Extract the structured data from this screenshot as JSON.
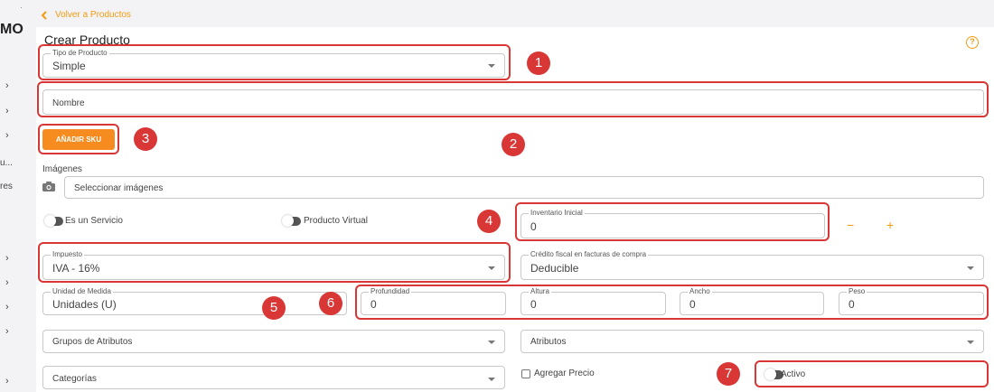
{
  "sidebar": {
    "logo": "MO",
    "dot": "·",
    "truncated_1": "u...",
    "truncated_2": "res",
    "chevron": "›"
  },
  "nav": {
    "back_label": "Volver a Productos",
    "back_icon": "chevron-left-icon"
  },
  "page": {
    "title": "Crear Producto",
    "help_glyph": "?"
  },
  "form": {
    "tipo": {
      "label": "Tipo de Producto",
      "value": "Simple"
    },
    "nombre": {
      "placeholder": "Nombre"
    },
    "add_sku": "AÑADIR SKU",
    "imagenes": {
      "label": "Imágenes",
      "placeholder": "Seleccionar imágenes"
    },
    "es_servicio": "Es un Servicio",
    "producto_virtual": "Producto Virtual",
    "inventario": {
      "label": "Inventario Inicial",
      "value": "0",
      "minus": "−",
      "plus": "+"
    },
    "impuesto": {
      "label": "Impuesto",
      "value": "IVA - 16%"
    },
    "credito": {
      "label": "Crédito fiscal en facturas de compra",
      "value": "Deducible"
    },
    "unidad": {
      "label": "Unidad de Medida",
      "value": "Unidades (U)"
    },
    "profundidad": {
      "label": "Profundidad",
      "value": "0"
    },
    "altura": {
      "label": "Altura",
      "value": "0"
    },
    "ancho": {
      "label": "Ancho",
      "value": "0"
    },
    "peso": {
      "label": "Peso",
      "value": "0"
    },
    "grupos_atributos": "Grupos de Atributos",
    "atributos": "Atributos",
    "categorias": "Categorías",
    "agregar_precio": "Agregar Precio",
    "activo": "Activo"
  },
  "annotations": {
    "badges": [
      "1",
      "2",
      "3",
      "4",
      "5",
      "6",
      "7"
    ],
    "color": "#d93636"
  },
  "colors": {
    "accent": "#f68b1f",
    "annotation": "#d93636"
  }
}
